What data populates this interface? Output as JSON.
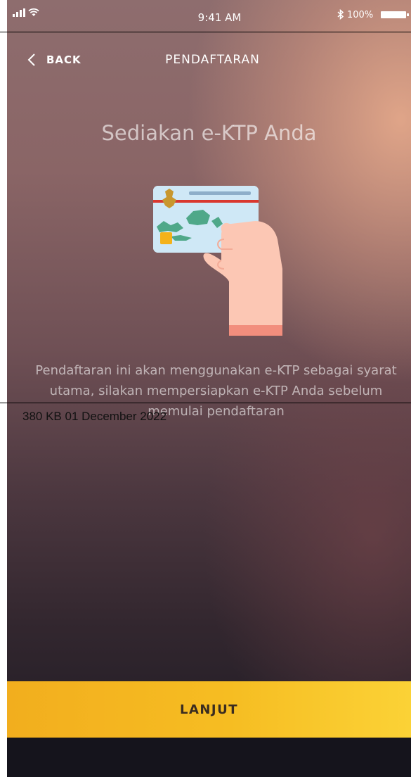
{
  "status_bar": {
    "time": "9:41 AM",
    "battery_percent": "100%",
    "icons": [
      "signal-icon",
      "wifi-icon",
      "bluetooth-icon",
      "battery-icon"
    ]
  },
  "nav": {
    "back_label": "BACK",
    "title": "PENDAFTARAN"
  },
  "content": {
    "heading": "Sediakan e-KTP Anda",
    "description": "Pendaftaran ini akan menggunakan e-KTP sebagai syarat utama, silakan mempersiapkan e-KTP Anda sebelum memulai pendaftaran",
    "illustration": "hand-holding-id-card-icon"
  },
  "overlay": {
    "file_info": "380 KB 01 December 2022"
  },
  "actions": {
    "continue_label": "LANJUT"
  },
  "colors": {
    "button": "#f6bd22",
    "button_text": "#3a2c20",
    "card": "#cfe8f6",
    "card_stripe": "#d9382f",
    "map": "#4fa889",
    "chip": "#f4b21a",
    "hand": "#fcc7b4",
    "sleeve": "#f28e7d"
  }
}
